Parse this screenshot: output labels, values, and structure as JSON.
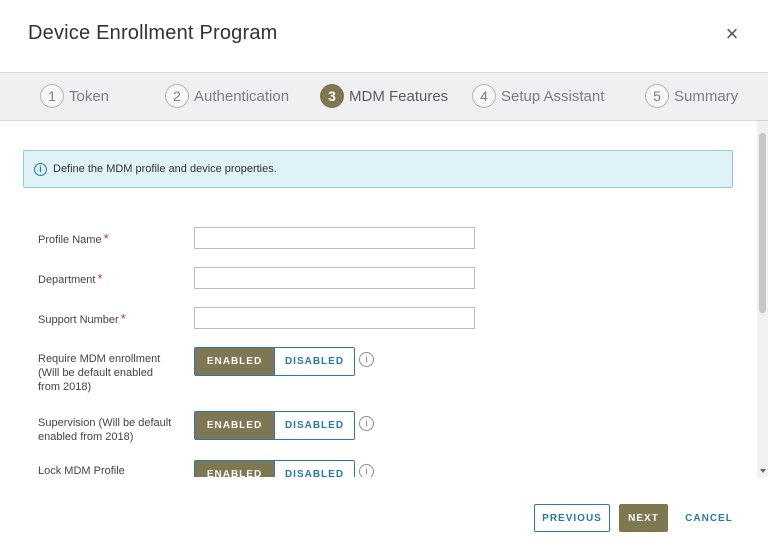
{
  "dialog": {
    "title": "Device Enrollment Program",
    "close_glyph": "×"
  },
  "steps": [
    {
      "num": "1",
      "label": "Token",
      "active": false
    },
    {
      "num": "2",
      "label": "Authentication",
      "active": false
    },
    {
      "num": "3",
      "label": "MDM Features",
      "active": true
    },
    {
      "num": "4",
      "label": "Setup Assistant",
      "active": false
    },
    {
      "num": "5",
      "label": "Summary",
      "active": false
    }
  ],
  "info": {
    "icon": "info-icon",
    "text": "Define the MDM profile and device properties."
  },
  "form": {
    "profile_name": {
      "label": "Profile Name",
      "value": ""
    },
    "department": {
      "label": "Department",
      "value": ""
    },
    "support_number": {
      "label": "Support Number",
      "value": ""
    },
    "required_marker": "*",
    "require_mdm": {
      "label_lines": [
        "Require MDM enrollment",
        "(Will be default enabled",
        "from 2018)"
      ],
      "selected": "ENABLED"
    },
    "supervision": {
      "label_lines": [
        "Supervision (Will be default",
        "enabled from 2018)"
      ],
      "selected": "ENABLED"
    },
    "lock_mdm": {
      "label_lines": [
        "Lock MDM Profile"
      ],
      "selected": "ENABLED"
    },
    "toggle_on_label": "ENABLED",
    "toggle_off_label": "DISABLED",
    "tooltip_glyph": "i"
  },
  "footer": {
    "previous": "PREVIOUS",
    "next": "NEXT",
    "cancel": "CANCEL"
  },
  "colors": {
    "accent": "#7f7652",
    "link": "#2a7aa0",
    "info_bg": "#def2f7",
    "required": "#c0392b"
  }
}
